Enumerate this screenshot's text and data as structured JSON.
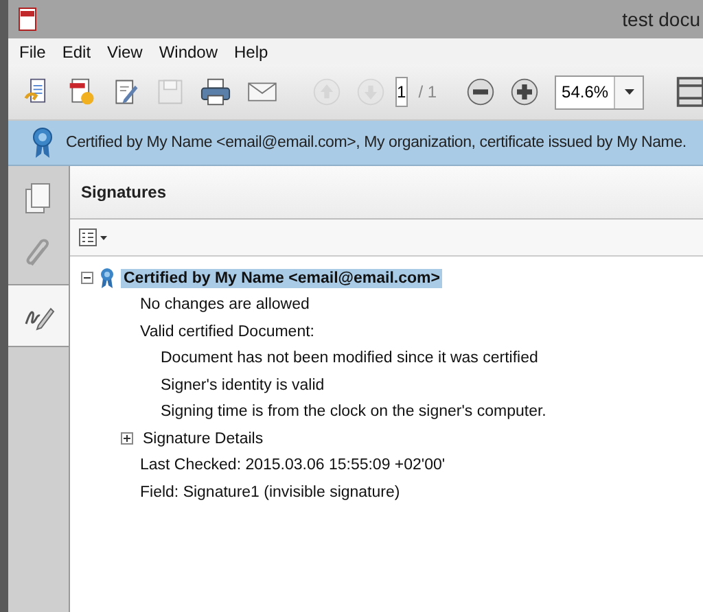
{
  "window": {
    "title": "test docu"
  },
  "menu": [
    "File",
    "Edit",
    "View",
    "Window",
    "Help"
  ],
  "toolbar": {
    "buttons": [
      {
        "kind": "create",
        "disabled": false
      },
      {
        "kind": "convert",
        "disabled": false
      },
      {
        "kind": "edit",
        "disabled": false
      },
      {
        "kind": "save",
        "disabled": true
      },
      {
        "kind": "print",
        "disabled": false
      },
      {
        "kind": "email",
        "disabled": false
      },
      {
        "kind": "prev",
        "disabled": true
      },
      {
        "kind": "next",
        "disabled": true
      }
    ],
    "page": "1",
    "page_total": "/ 1",
    "zoom": "54.6%"
  },
  "banner": {
    "text": "Certified by My Name <email@email.com>, My organization, certificate issued by My Name."
  },
  "sidebar": {
    "tabs": [
      {
        "kind": "pages",
        "selected": false
      },
      {
        "kind": "attachments",
        "selected": false
      },
      {
        "kind": "signatures",
        "selected": true
      }
    ]
  },
  "panel": {
    "title": "Signatures",
    "tree": [
      {
        "kind": "certificate",
        "label": "Certified by My Name <email@email.com>",
        "expanded": true,
        "selected": true,
        "children": [
          {
            "kind": "text",
            "label": "No changes are allowed"
          },
          {
            "kind": "text",
            "label": "Valid certified Document:",
            "children": [
              {
                "kind": "text",
                "label": "Document has not been modified since it was certified"
              },
              {
                "kind": "text",
                "label": "Signer's identity is valid"
              },
              {
                "kind": "text",
                "label": "Signing time is from the clock on the signer's computer."
              }
            ]
          },
          {
            "kind": "group",
            "label": "Signature Details",
            "expanded": false
          },
          {
            "kind": "text",
            "label": "Last Checked: 2015.03.06 15:55:09 +02'00'"
          },
          {
            "kind": "text",
            "label": "Field: Signature1 (invisible signature)"
          }
        ]
      }
    ]
  }
}
